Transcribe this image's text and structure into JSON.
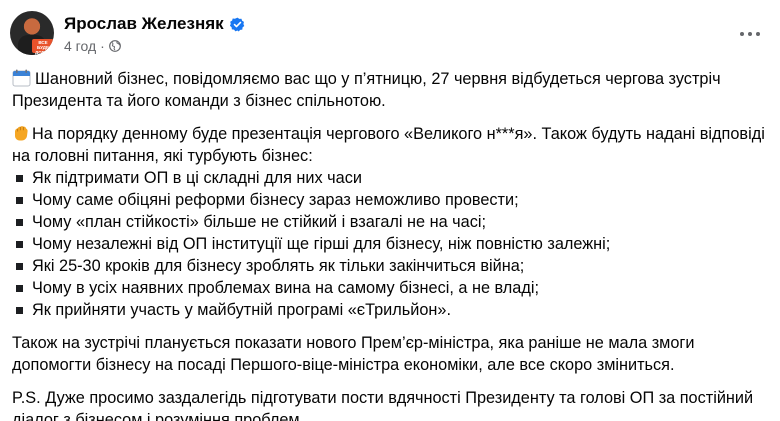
{
  "post": {
    "author": "Ярослав Железняк",
    "time": "4 год",
    "separator": "·",
    "avatar_badge": "ВСЕ БУДЕ ДОБРЕ"
  },
  "content": {
    "p1_emoji": "calendar-icon",
    "p1": "Шановний бізнес, повідомляємо вас що у п’ятницю, 27 червня відбудеться чергова зустріч Президента та його команди з бізнес спільнотою.",
    "p2_emoji": "fist-icon",
    "p2": "На порядку денному буде презентація чергового «Великого н***я». Також будуть надані відповіді на головні питання, які турбують бізнес:",
    "items": [
      "Як підтримати ОП в ці складні для них часи",
      "Чому саме обіцяні реформи бізнесу зараз неможливо провести;",
      "Чому «план стійкості» більше не стійкий і взагалі не на часі;",
      "Чому незалежні від ОП інституції ще гірші для бізнесу, ніж повністю залежні;",
      "Які 25-30 кроків для бізнесу зроблять як тільки закінчиться війна;",
      "Чому в усіх наявних проблемах вина на самому бізнесі, а не владі;",
      "Як прийняти участь у майбутній програмі «єТрильйон»."
    ],
    "p3": "Також на зустрічі планується показати нового Прем’єр-міністра, яка раніше не мала змоги допомогти бізнесу на посаді Першого-віце-міністра економіки, але все скоро зміниться.",
    "p4": "P.S. Дуже просимо заздалегідь підготувати пости вдячності Президенту та голові ОП за постійний діалог з бізнесом і розуміння проблем."
  },
  "colors": {
    "verified": "#1877f2",
    "secondary_text": "#65676b",
    "fist": "#f5a623"
  }
}
